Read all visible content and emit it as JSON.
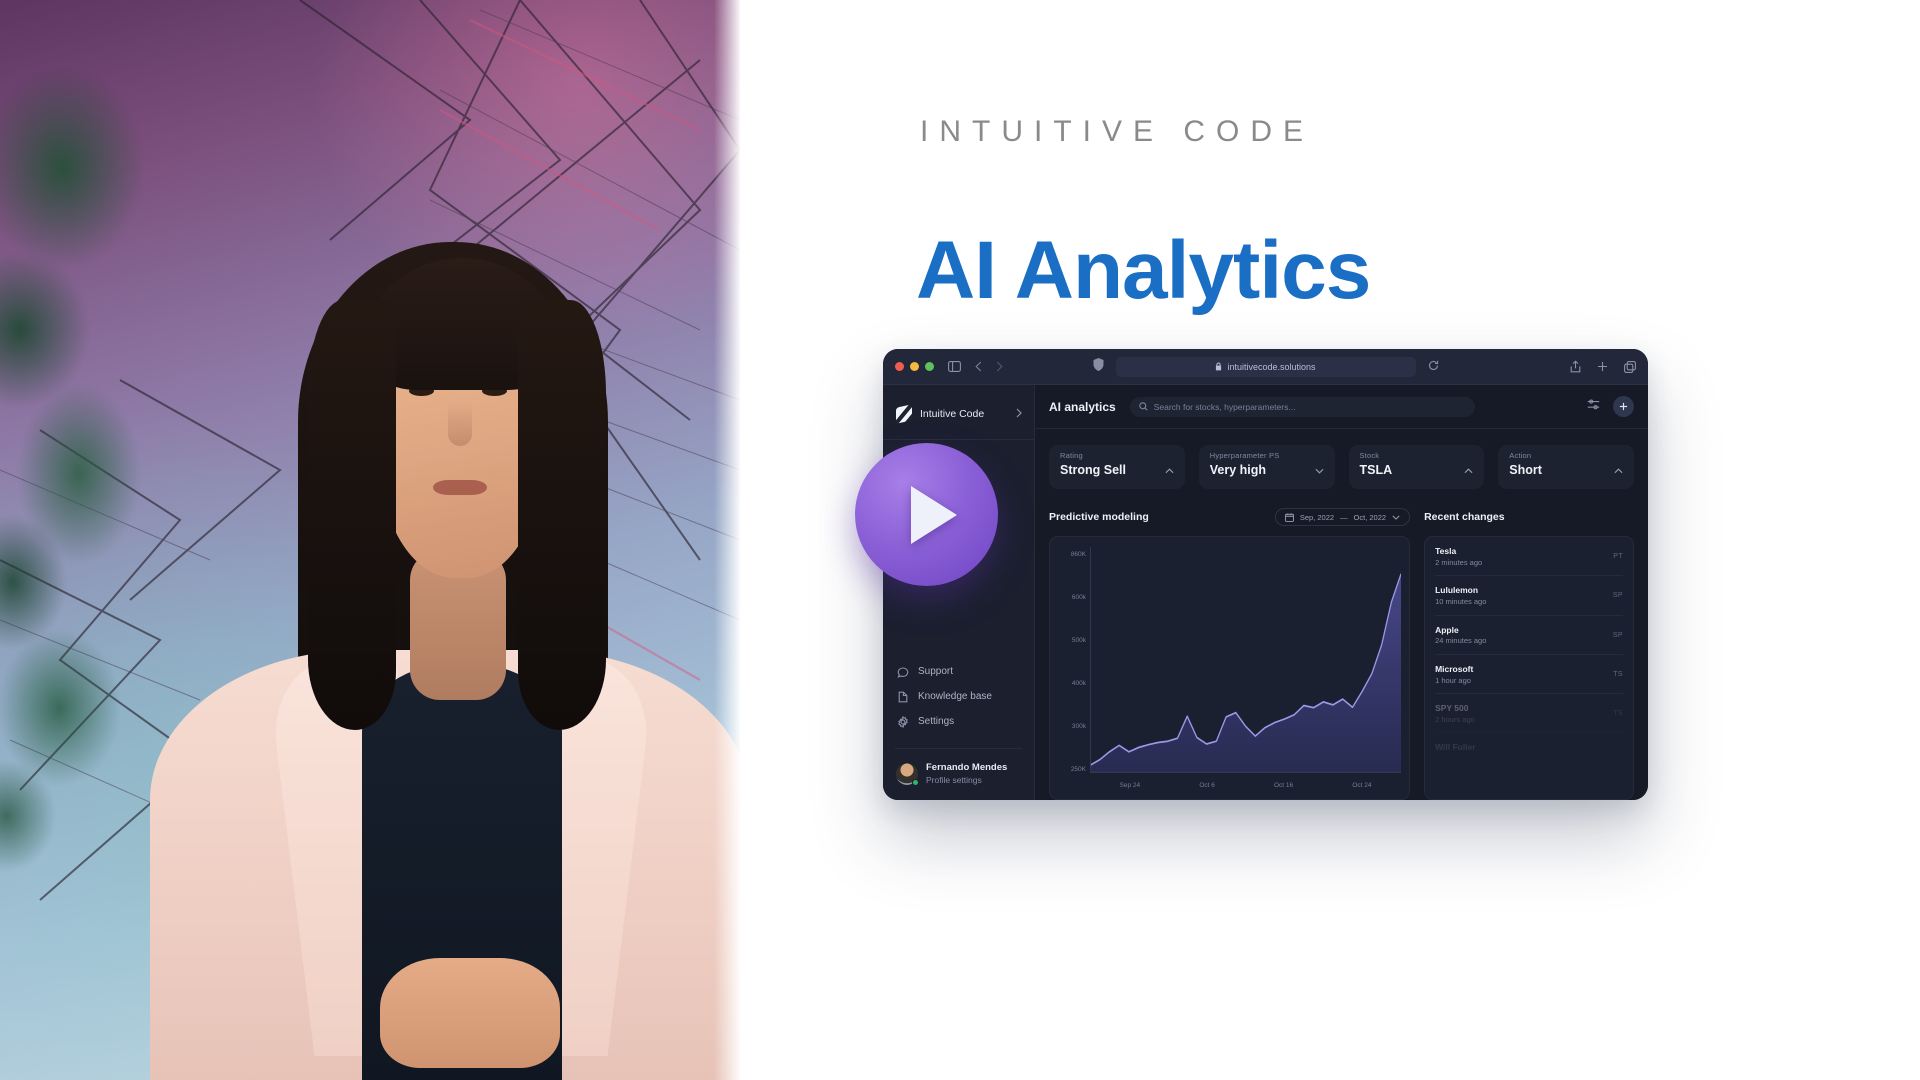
{
  "hero": {
    "eyebrow": "INTUITIVE CODE",
    "headline": "AI Analytics",
    "accent_color": "#1a6fc4"
  },
  "play_overlay": {
    "name": "play-button",
    "color": "#8a5fd6"
  },
  "browser": {
    "url": "intuitivecode.solutions",
    "lock_icon": "lock-icon",
    "traffic_lights": [
      "close",
      "minimize",
      "zoom"
    ],
    "icons": [
      "sidebar-toggle",
      "back",
      "forward",
      "shield",
      "reload",
      "share",
      "new-tab",
      "tabs"
    ]
  },
  "sidebar": {
    "brand": "Intuitive Code",
    "items": [
      {
        "label": "Support",
        "icon": "chat-icon"
      },
      {
        "label": "Knowledge base",
        "icon": "document-icon"
      },
      {
        "label": "Settings",
        "icon": "gear-icon"
      }
    ],
    "profile": {
      "name": "Fernando Mendes",
      "subtitle": "Profile settings",
      "status": "online"
    }
  },
  "topbar": {
    "title": "AI analytics",
    "search_placeholder": "Search for stocks, hyperparameters...",
    "filters_icon": "sliders-icon",
    "add_label": "+"
  },
  "filters": [
    {
      "label": "Rating",
      "value": "Strong Sell",
      "chevron": "up"
    },
    {
      "label": "Hyperparameter PS",
      "value": "Very high",
      "chevron": "down"
    },
    {
      "label": "Stock",
      "value": "TSLA",
      "chevron": "up"
    },
    {
      "label": "Action",
      "value": "Short",
      "chevron": "up"
    }
  ],
  "predictive": {
    "title": "Predictive modeling",
    "date_from": "Sep, 2022",
    "date_sep": "—",
    "date_to": "Oct, 2022",
    "calendar_icon": "calendar-icon"
  },
  "recent": {
    "title": "Recent changes",
    "items": [
      {
        "name": "Tesla",
        "time": "2 minutes ago",
        "tag": "PT"
      },
      {
        "name": "Lululemon",
        "time": "10 minutes ago",
        "tag": "SP"
      },
      {
        "name": "Apple",
        "time": "24 minutes ago",
        "tag": "SP"
      },
      {
        "name": "Microsoft",
        "time": "1 hour ago",
        "tag": "TS"
      },
      {
        "name": "SPY 500",
        "time": "2 hours ago",
        "tag": "TS"
      },
      {
        "name": "Will Fuller",
        "time": "",
        "tag": ""
      }
    ]
  },
  "chart_data": {
    "type": "area",
    "title": "Predictive modeling",
    "xlabel": "",
    "ylabel": "",
    "grid": false,
    "legend": "none",
    "line_color": "#8f8ce0",
    "fill_color": "#3a3a72",
    "ylim": [
      250000,
      860000
    ],
    "ytick_labels": [
      "860K",
      "600k",
      "500k",
      "400k",
      "300k",
      "250K"
    ],
    "ytick_values": [
      860000,
      600000,
      500000,
      400000,
      300000,
      250000
    ],
    "xtick_labels": [
      "Sep 24",
      "Oct 6",
      "Oct 16",
      "Oct 24"
    ],
    "x": [
      0,
      1,
      2,
      3,
      4,
      5,
      6,
      7,
      8,
      9,
      10,
      11,
      12,
      13,
      14,
      15,
      16,
      17,
      18,
      19,
      20,
      21,
      22,
      23,
      24,
      25,
      26,
      27,
      28,
      29,
      30,
      31,
      32
    ],
    "values": [
      262000,
      278000,
      300000,
      318000,
      300000,
      312000,
      320000,
      326000,
      330000,
      338000,
      400000,
      340000,
      322000,
      330000,
      398000,
      410000,
      372000,
      344000,
      368000,
      382000,
      392000,
      404000,
      430000,
      424000,
      440000,
      432000,
      448000,
      425000,
      470000,
      520000,
      600000,
      720000,
      800000
    ]
  }
}
